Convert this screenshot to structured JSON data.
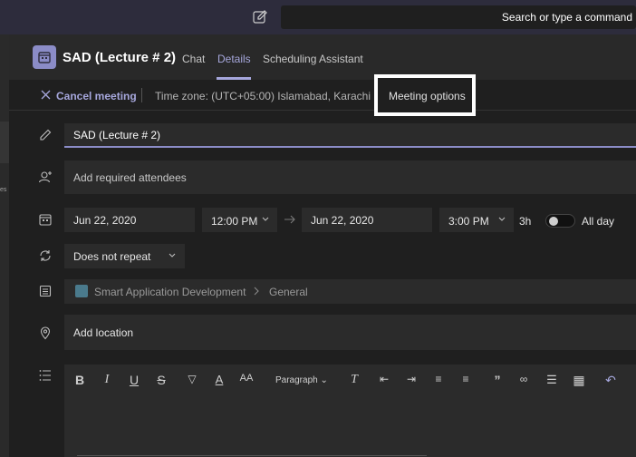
{
  "search": {
    "placeholder": "Search or type a command"
  },
  "meeting": {
    "title": "SAD (Lecture # 2)",
    "tabs": [
      "Chat",
      "Details",
      "Scheduling Assistant"
    ],
    "active_tab": "Details"
  },
  "toolbar": {
    "cancel_label": "Cancel meeting",
    "timezone": "Time zone: (UTC+05:00) Islamabad, Karachi",
    "options_label": "Meeting options"
  },
  "form": {
    "title_value": "SAD (Lecture # 2)",
    "attendees_placeholder": "Add required attendees",
    "start_date": "Jun 22, 2020",
    "start_time": "12:00 PM",
    "end_date": "Jun 22, 2020",
    "end_time": "3:00 PM",
    "duration": "3h",
    "all_day_label": "All day",
    "all_day": false,
    "repeat": "Does not repeat",
    "channel_team": "Smart Application Development",
    "channel_name": "General",
    "location_placeholder": "Add location"
  },
  "editor": {
    "paragraph_label": "Paragraph"
  },
  "colors": {
    "accent": "#a6a7dc",
    "topbar": "#2d2c3c",
    "background": "#1f1f1f",
    "field": "#2b2b2b"
  },
  "icons": [
    "compose-icon",
    "calendar-icon",
    "close-icon",
    "pencil-icon",
    "add-person-icon",
    "calendar-small-icon",
    "arrow-right-icon",
    "repeat-icon",
    "channel-icon",
    "location-icon",
    "list-icon"
  ]
}
